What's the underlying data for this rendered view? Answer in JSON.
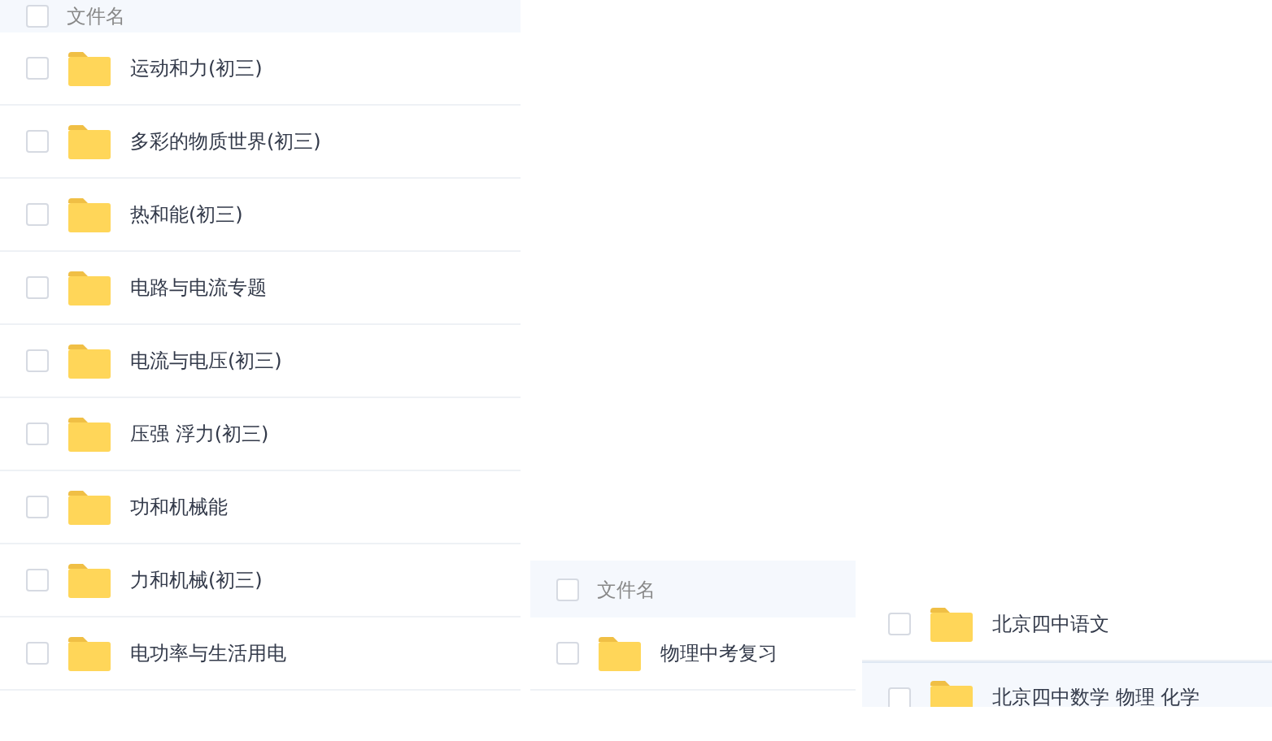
{
  "panels": [
    {
      "header": {
        "label": "文件名",
        "checked": false
      },
      "rows": [
        {
          "name": "运动和力(初三)",
          "checked": false,
          "selected": false
        },
        {
          "name": "多彩的物质世界(初三)",
          "checked": false,
          "selected": false
        },
        {
          "name": "热和能(初三)",
          "checked": false,
          "selected": false
        },
        {
          "name": "电路与电流专题",
          "checked": false,
          "selected": false
        },
        {
          "name": "电流与电压(初三)",
          "checked": false,
          "selected": false
        },
        {
          "name": "压强 浮力(初三)",
          "checked": false,
          "selected": false
        },
        {
          "name": "功和机械能",
          "checked": false,
          "selected": false
        },
        {
          "name": "力和机械(初三)",
          "checked": false,
          "selected": false
        },
        {
          "name": "电功率与生活用电",
          "checked": false,
          "selected": false
        }
      ]
    },
    {
      "header": {
        "label": "文件名",
        "checked": false
      },
      "rows": [
        {
          "name": "物理中考复习",
          "checked": false,
          "selected": false
        }
      ]
    },
    {
      "rows": [
        {
          "name": "北京四中语文",
          "checked": false,
          "selected": false
        },
        {
          "name": "北京四中数学 物理 化学",
          "checked": false,
          "selected": true
        }
      ]
    }
  ]
}
